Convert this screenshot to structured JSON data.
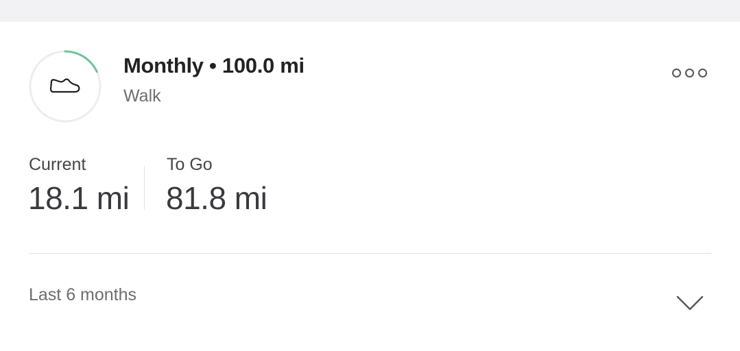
{
  "goal": {
    "title": "Monthly • 100.0 mi",
    "activity": "Walk",
    "progress_fraction": 0.181,
    "activity_icon": "shoe-icon",
    "menu_icon": "more-icon",
    "accent_color": "#6cc49a"
  },
  "stats": {
    "current_label": "Current",
    "current_value": "18.1 mi",
    "to_go_label": "To Go",
    "to_go_value": "81.8 mi"
  },
  "period": {
    "label": "Last 6 months",
    "icon": "chevron-down-icon"
  }
}
